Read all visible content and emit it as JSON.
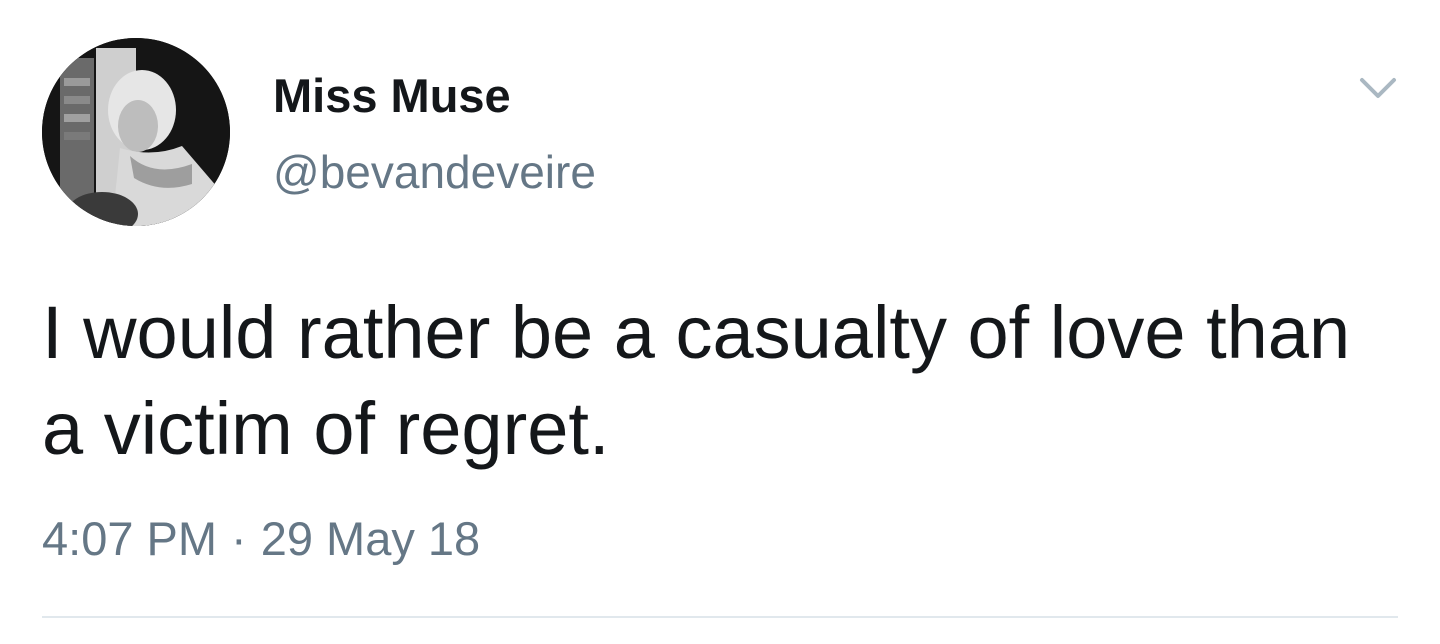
{
  "author": {
    "display_name": "Miss Muse",
    "handle": "@bevandeveire",
    "avatar_icon": "profile-photo-grayscale"
  },
  "tweet": {
    "text": "I would rather be a casualty of love than a victim of regret.",
    "time": "4:07 PM",
    "separator": "·",
    "date": "29 May 18"
  },
  "menu": {
    "icon": "chevron-down-icon"
  },
  "colors": {
    "text": "#14171a",
    "secondary": "#657786",
    "divider": "#e1e8ed",
    "caret": "#aab8c2"
  }
}
